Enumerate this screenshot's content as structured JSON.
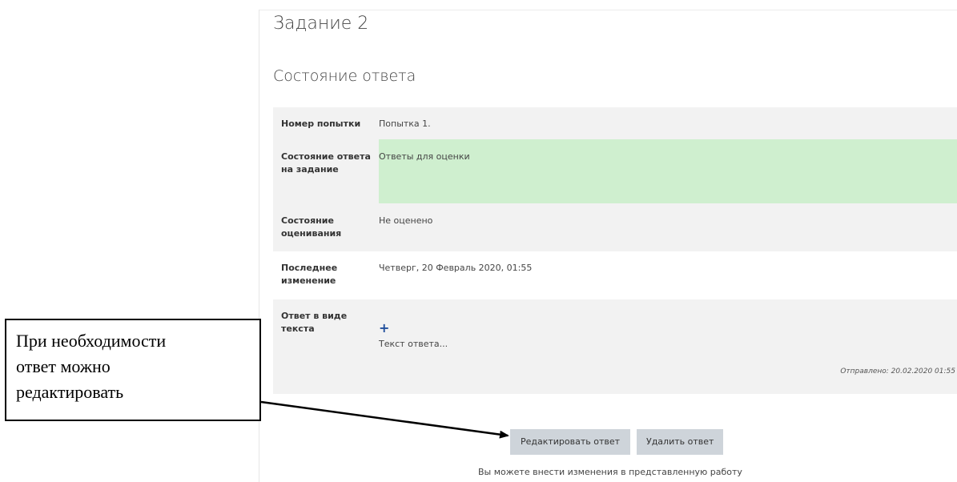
{
  "assignment": {
    "title": "Задание 2",
    "section_title": "Состояние ответа"
  },
  "submission_status": {
    "rows": [
      {
        "label": "Номер попытки",
        "value": "Попытка 1."
      },
      {
        "label": "Состояние ответа на задание",
        "value": "Ответы для оценки"
      },
      {
        "label": "Состояние оценивания",
        "value": "Не оценено"
      },
      {
        "label": "Последнее изменение",
        "value": "Четверг, 20 Февраль 2020, 01:55"
      },
      {
        "label": "Ответ в виде текста",
        "value": "Текст ответа...",
        "submitted": "Отправлено: 20.02.2020 01:55"
      }
    ]
  },
  "actions": {
    "edit_label": "Редактировать ответ",
    "delete_label": "Удалить ответ",
    "hint": "Вы можете внести изменения в представленную работу"
  },
  "callout": {
    "lines": [
      "При необходимости",
      "ответ можно",
      "редактировать"
    ]
  },
  "icons": {
    "expand": "plus-icon"
  },
  "colors": {
    "submitted_bg": "#cfefcf",
    "row_bg": "#f2f2f2",
    "button_bg": "#ced4da",
    "plus": "#1f4e9c"
  }
}
